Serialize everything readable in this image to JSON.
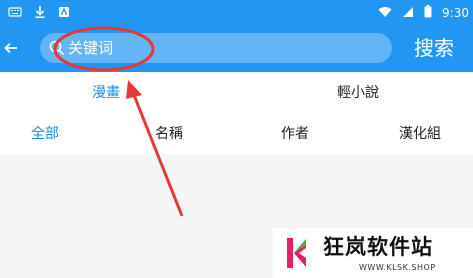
{
  "status_bar": {
    "time": "9:30",
    "left_icons": [
      "keyboard-icon",
      "download-icon",
      "notification-icon"
    ],
    "right_icons": [
      "wifi-icon",
      "signal-icon",
      "battery-icon"
    ]
  },
  "toolbar": {
    "back_icon": "back-arrow-icon",
    "search_placeholder": "关键词",
    "search_button_label": "搜索"
  },
  "tabs": [
    {
      "label": "漫畫",
      "active": true
    },
    {
      "label": "輕小說",
      "active": false
    }
  ],
  "filters": [
    {
      "label": "全部",
      "active": true
    },
    {
      "label": "名稱",
      "active": false
    },
    {
      "label": "作者",
      "active": false
    },
    {
      "label": "漢化組",
      "active": false
    }
  ],
  "watermark": {
    "brand_text": "狂岚软件站",
    "url": "WWW.KLSK.SHOP"
  },
  "colors": {
    "primary": "#2196f3",
    "search_field": "#64b5f6",
    "accent_text": "#1e88e5",
    "annotation": "#e53935"
  }
}
